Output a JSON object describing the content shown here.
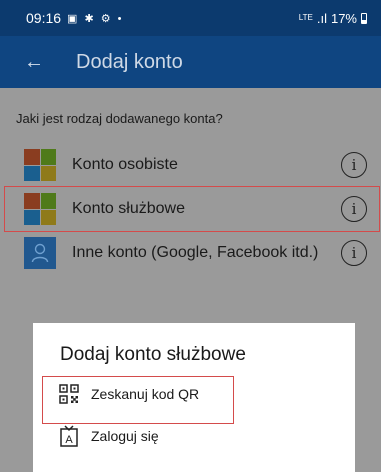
{
  "status_bar": {
    "time": "09:16",
    "left_icons": "▣ ✱ ⚙ •",
    "network": "LTE",
    "signal": ".ıl",
    "battery": "17%"
  },
  "app_bar": {
    "back_icon": "back-arrow-icon",
    "title": "Dodaj konto"
  },
  "question": "Jaki jest rodzaj dodawanego konta?",
  "accounts": [
    {
      "label": "Konto osobiste",
      "icon": "microsoft-logo-icon"
    },
    {
      "label": "Konto służbowe",
      "icon": "microsoft-logo-icon"
    },
    {
      "label": "Inne konto (Google, Facebook itd.)",
      "icon": "person-icon"
    }
  ],
  "info_glyph": "i",
  "dialog": {
    "title": "Dodaj konto służbowe",
    "items": [
      {
        "label": "Zeskanuj kod QR",
        "icon": "qr-code-icon"
      },
      {
        "label": "Zaloguj się",
        "icon": "badge-login-icon"
      }
    ]
  },
  "colors": {
    "status_bar": "#0c3a6e",
    "app_bar": "#0f4581",
    "overlay": "#9a9a9a",
    "highlight": "#d44b4b"
  }
}
